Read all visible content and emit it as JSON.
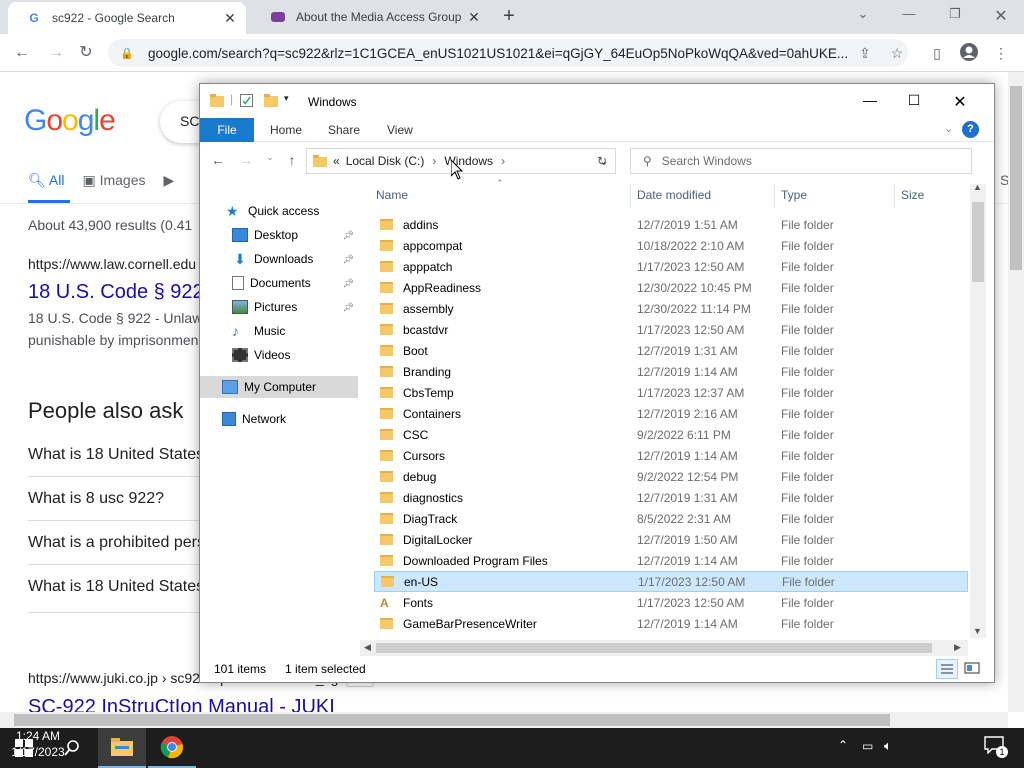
{
  "browser": {
    "tabs": [
      {
        "title": "sc922 - Google Search",
        "favicon": "G"
      },
      {
        "title": "About the Media Access Group a"
      }
    ],
    "url": "google.com/search?q=sc922&rlz=1C1GCEA_enUS1021US1021&ei=qGjGY_64EuOp5NoPkoWqQA&ved=0ahUKE..."
  },
  "google": {
    "logo": "Google",
    "search_value": "SC",
    "tabs": {
      "all": "All",
      "images": "Images"
    },
    "results_count": "About 43,900 results (0.41",
    "result1_url": "https://www.law.cornell.edu",
    "result1_title": "18 U.S. Code § 922",
    "result1_snippet1": "18 U.S. Code § 922 - Unlawf",
    "result1_snippet2": "punishable by imprisonmen",
    "paa_title": "People also ask",
    "paa": [
      "What is 18 United States",
      "What is 8 usc 922?",
      "What is a prohibited pers",
      "What is 18 United States"
    ],
    "result2_url": "https://www.juki.co.jp › sc922 › pdf › instruction_cg",
    "result2_badge": "PDF",
    "result2_title": "SC-922 InStruCtIon Manual - JUKI",
    "partial_letter": "S"
  },
  "explorer": {
    "title": "Windows",
    "ribbon": {
      "file": "File",
      "home": "Home",
      "share": "Share",
      "view": "View"
    },
    "breadcrumb": {
      "prefix": "«",
      "drive": "Local Disk (C:)",
      "folder": "Windows"
    },
    "search_placeholder": "Search Windows",
    "nav": {
      "quick_access": "Quick access",
      "desktop": "Desktop",
      "downloads": "Downloads",
      "documents": "Documents",
      "pictures": "Pictures",
      "music": "Music",
      "videos": "Videos",
      "my_computer": "My Computer",
      "network": "Network"
    },
    "columns": {
      "name": "Name",
      "date": "Date modified",
      "type": "Type",
      "size": "Size"
    },
    "files": [
      {
        "name": "addins",
        "date": "12/7/2019 1:51 AM",
        "type": "File folder"
      },
      {
        "name": "appcompat",
        "date": "10/18/2022 2:10 AM",
        "type": "File folder"
      },
      {
        "name": "apppatch",
        "date": "1/17/2023 12:50 AM",
        "type": "File folder"
      },
      {
        "name": "AppReadiness",
        "date": "12/30/2022 10:45 PM",
        "type": "File folder"
      },
      {
        "name": "assembly",
        "date": "12/30/2022 11:14 PM",
        "type": "File folder"
      },
      {
        "name": "bcastdvr",
        "date": "1/17/2023 12:50 AM",
        "type": "File folder"
      },
      {
        "name": "Boot",
        "date": "12/7/2019 1:31 AM",
        "type": "File folder"
      },
      {
        "name": "Branding",
        "date": "12/7/2019 1:14 AM",
        "type": "File folder"
      },
      {
        "name": "CbsTemp",
        "date": "1/17/2023 12:37 AM",
        "type": "File folder"
      },
      {
        "name": "Containers",
        "date": "12/7/2019 2:16 AM",
        "type": "File folder"
      },
      {
        "name": "CSC",
        "date": "9/2/2022 6:11 PM",
        "type": "File folder"
      },
      {
        "name": "Cursors",
        "date": "12/7/2019 1:14 AM",
        "type": "File folder"
      },
      {
        "name": "debug",
        "date": "9/2/2022 12:54 PM",
        "type": "File folder"
      },
      {
        "name": "diagnostics",
        "date": "12/7/2019 1:31 AM",
        "type": "File folder"
      },
      {
        "name": "DiagTrack",
        "date": "8/5/2022 2:31 AM",
        "type": "File folder"
      },
      {
        "name": "DigitalLocker",
        "date": "12/7/2019 1:50 AM",
        "type": "File folder"
      },
      {
        "name": "Downloaded Program Files",
        "date": "12/7/2019 1:14 AM",
        "type": "File folder"
      },
      {
        "name": "en-US",
        "date": "1/17/2023 12:50 AM",
        "type": "File folder",
        "selected": true
      },
      {
        "name": "Fonts",
        "date": "1/17/2023 12:50 AM",
        "type": "File folder"
      },
      {
        "name": "GameBarPresenceWriter",
        "date": "12/7/2019 1:14 AM",
        "type": "File folder"
      }
    ],
    "status": {
      "items": "101 items",
      "selected": "1 item selected"
    }
  },
  "taskbar": {
    "time": "1:24 AM",
    "date": "1/17/2023",
    "notifications": "1"
  }
}
